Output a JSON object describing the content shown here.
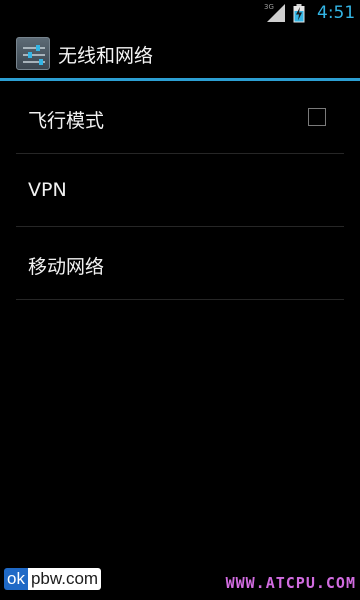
{
  "status_bar": {
    "network_type": "3G",
    "time": "4:51",
    "signal_icon": "signal-icon",
    "battery_icon": "battery-charging-icon",
    "accent_color": "#33b5e5"
  },
  "action_bar": {
    "icon": "settings-sliders-icon",
    "title": "无线和网络",
    "divider_color": "#2c9fd3"
  },
  "settings": {
    "items": [
      {
        "label": "飞行模式",
        "has_checkbox": true,
        "checked": false
      },
      {
        "label": "VPN",
        "has_checkbox": false
      },
      {
        "label": "移动网络",
        "has_checkbox": false
      }
    ]
  },
  "watermarks": {
    "left_prefix": "ok",
    "left_suffix": "pbw.com",
    "right": "WWW.ATCPU.COM"
  }
}
